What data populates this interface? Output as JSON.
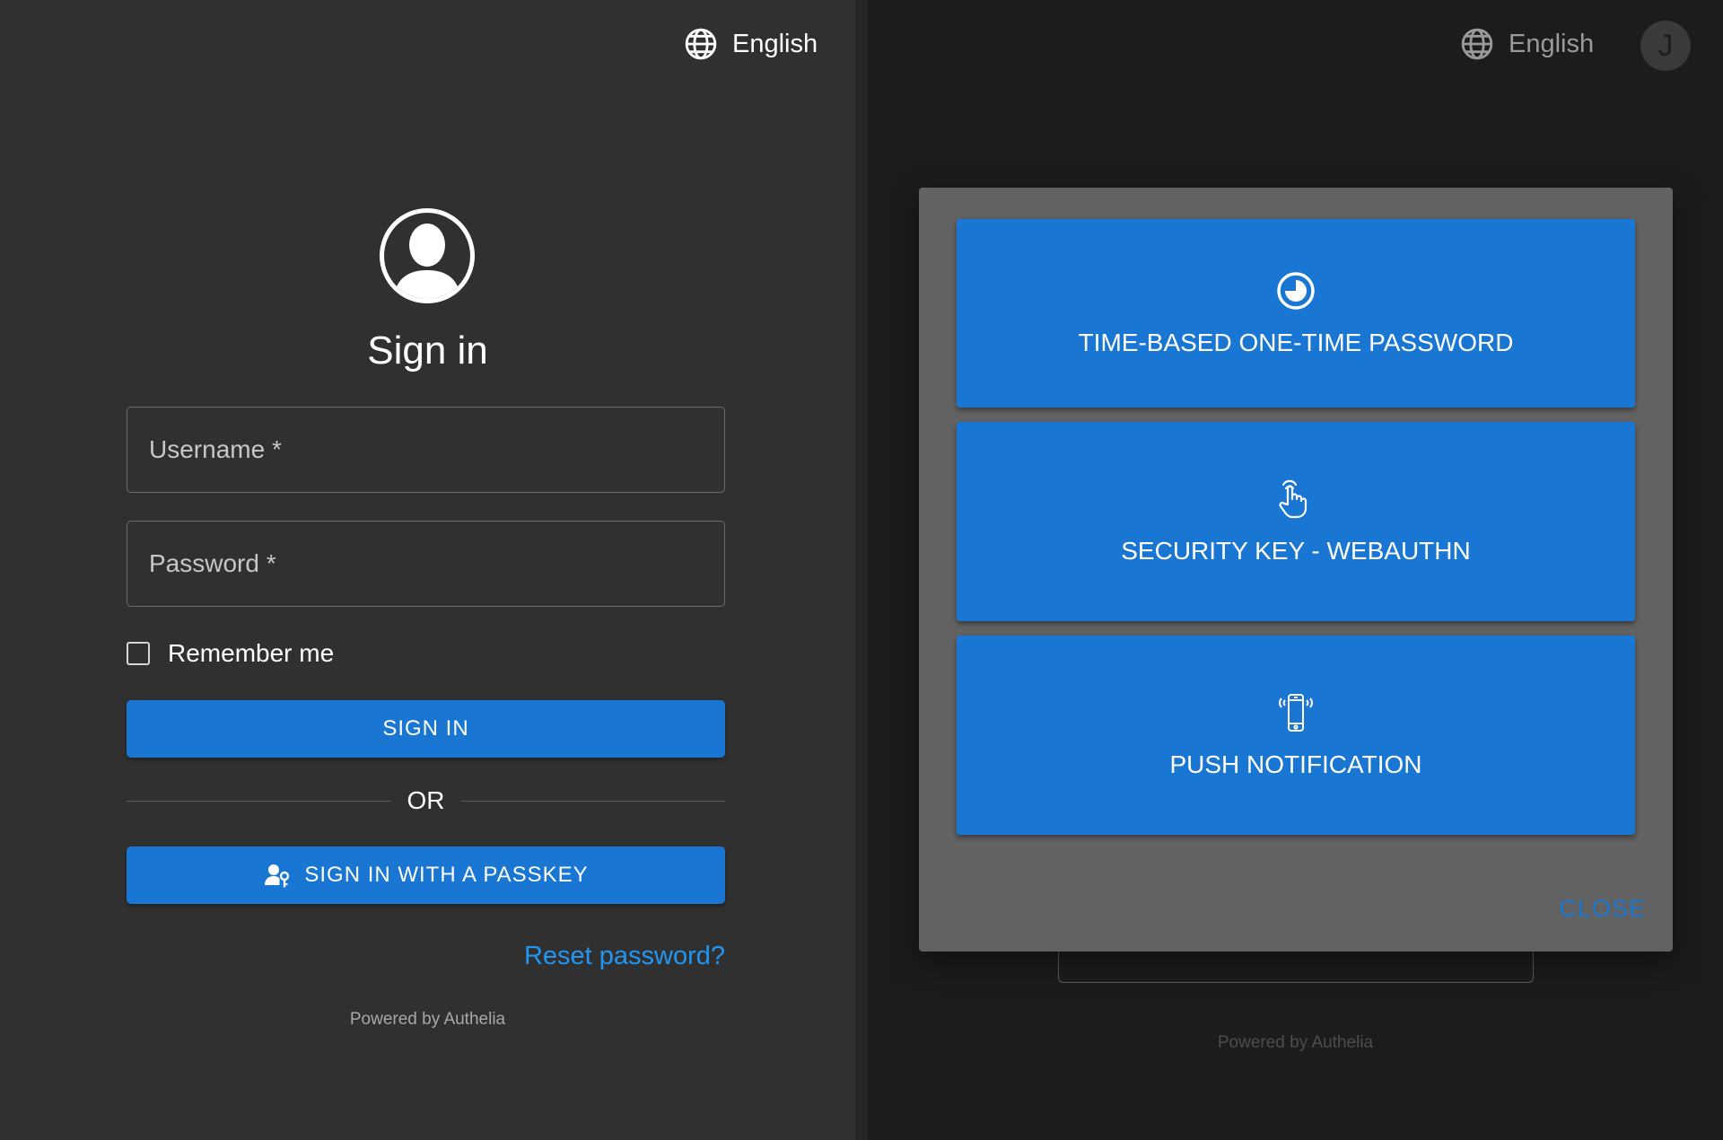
{
  "left": {
    "language": "English",
    "title": "Sign in",
    "username_placeholder": "Username *",
    "password_placeholder": "Password *",
    "remember_label": "Remember me",
    "signin_label": "SIGN IN",
    "or_label": "OR",
    "passkey_label": "SIGN IN WITH A PASSKEY",
    "reset_label": "Reset password?",
    "powered": "Powered by Authelia"
  },
  "right": {
    "language": "English",
    "avatar_initial": "J",
    "dialog": {
      "methods": [
        {
          "label": "TIME-BASED ONE-TIME PASSWORD",
          "icon": "timer-icon"
        },
        {
          "label": "SECURITY KEY - WEBAUTHN",
          "icon": "touch-icon"
        },
        {
          "label": "PUSH NOTIFICATION",
          "icon": "phone-vibrate-icon"
        }
      ],
      "close_label": "CLOSE"
    },
    "powered": "Powered by Authelia"
  },
  "colors": {
    "accent": "#1976d2",
    "link": "#2196f3",
    "left_bg": "#303030",
    "right_bg": "#1c1c1c",
    "dialog_bg": "#626262"
  }
}
